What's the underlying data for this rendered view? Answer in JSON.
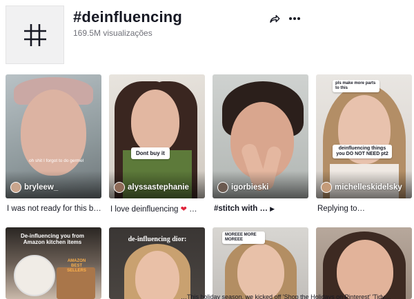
{
  "hashtag": {
    "title": "#deinfluencing",
    "views": "169.5M visualizações",
    "avatar_icon": "hashtag-icon",
    "share_icon": "share-arrow-icon",
    "more_icon": "more-dots-icon"
  },
  "videos": [
    {
      "username": "bryleew_",
      "caption": "I was not ready for this b…",
      "overlay_text": "oh shit I forgot to do germel"
    },
    {
      "username": "alyssastephanie",
      "caption": "I love deinfluencing",
      "caption_suffix": "…",
      "overlay_text": "Dont buy it"
    },
    {
      "username": "igorbieski",
      "caption": "#stitch with …"
    },
    {
      "username": "michelleskidelsky",
      "caption": "Replying to…",
      "overlay_text": "deinfluencing things you DO NOT NEED pt2",
      "reply_text": "pls make more parts to this"
    },
    {
      "overlay_text": "De-influencing you from Amazon kitchen items",
      "overlay_sub": "AMAZON BEST SELLERS"
    },
    {
      "overlay_text": "de-influencing dior:"
    },
    {
      "reply_text": "MOREEE MORE MOREEE"
    },
    {}
  ],
  "ticker": "…This holiday season, we kicked off 'Shop the Holidays on Pinterest' 'Tidy…"
}
